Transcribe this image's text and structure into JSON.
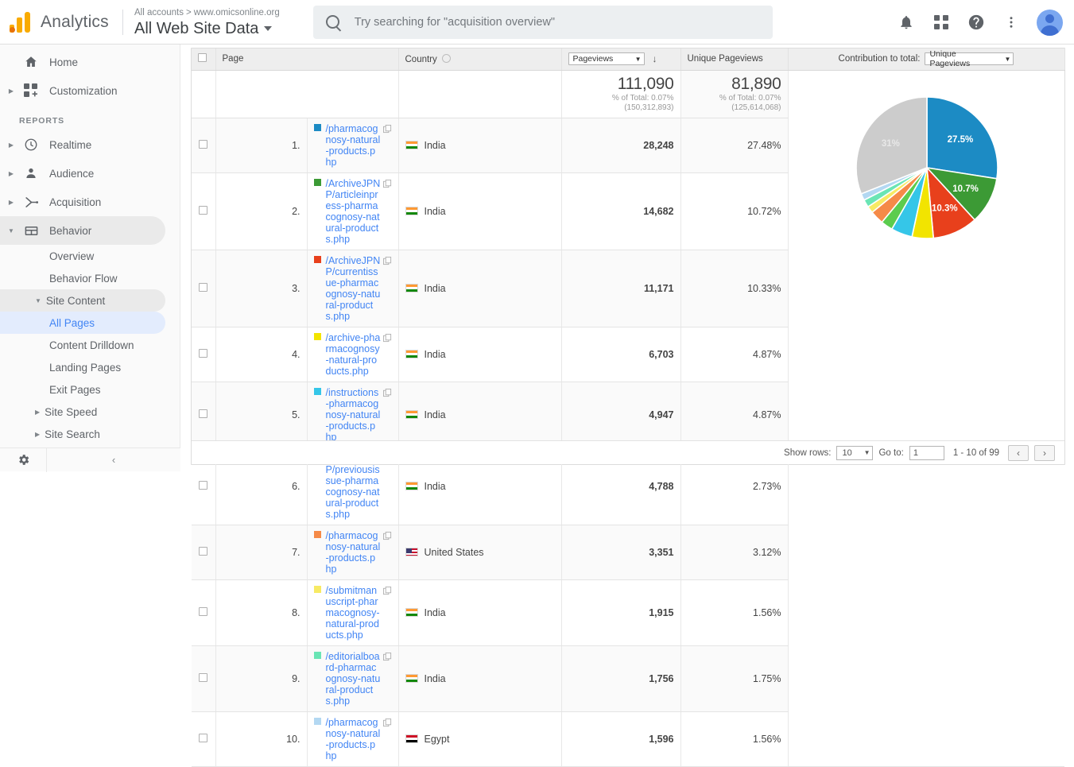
{
  "topbar": {
    "brand": "Analytics",
    "breadcrumb_account": "All accounts",
    "breadcrumb_sep": ">",
    "breadcrumb_property": "www.omicsonline.org",
    "view_name": "All Web Site Data",
    "search_placeholder": "Try searching for \"acquisition overview\"",
    "icons": [
      "notifications-bell-icon",
      "apps-grid-icon",
      "help-icon",
      "more-vert-icon",
      "avatar"
    ]
  },
  "sidebar": {
    "primary": [
      {
        "label": "Home",
        "icon": "home-icon",
        "expandable": false
      },
      {
        "label": "Customization",
        "icon": "customization-icon",
        "expandable": true
      }
    ],
    "section_label": "REPORTS",
    "reports": [
      {
        "label": "Realtime",
        "icon": "clock-icon",
        "expandable": true,
        "expanded": false
      },
      {
        "label": "Audience",
        "icon": "person-icon",
        "expandable": true,
        "expanded": false
      },
      {
        "label": "Acquisition",
        "icon": "acquisition-icon",
        "expandable": true,
        "expanded": false
      },
      {
        "label": "Behavior",
        "icon": "behavior-icon",
        "expandable": true,
        "expanded": true
      }
    ],
    "behavior_children": [
      {
        "label": "Overview",
        "type": "leaf",
        "selected": false
      },
      {
        "label": "Behavior Flow",
        "type": "leaf",
        "selected": false
      },
      {
        "label": "Site Content",
        "type": "group",
        "expanded": true
      },
      {
        "label": "All Pages",
        "type": "leaf-indent",
        "selected": true
      },
      {
        "label": "Content Drilldown",
        "type": "leaf-indent",
        "selected": false
      },
      {
        "label": "Landing Pages",
        "type": "leaf-indent",
        "selected": false
      },
      {
        "label": "Exit Pages",
        "type": "leaf-indent",
        "selected": false
      },
      {
        "label": "Site Speed",
        "type": "group",
        "expanded": false
      },
      {
        "label": "Site Search",
        "type": "group",
        "expanded": false
      }
    ],
    "footer": {
      "gear": "gear-icon",
      "collapse": "collapse-chevron-icon"
    }
  },
  "table": {
    "headers": {
      "page": "Page",
      "country": "Country",
      "pageviews_select": "Pageviews",
      "unique_pageviews": "Unique Pageviews",
      "contribution_label": "Contribution to total:",
      "contribution_select": "Unique Pageviews"
    },
    "summary": {
      "pageviews_value": "111,090",
      "pageviews_pct": "% of Total: 0.07%",
      "pageviews_total": "(150,312,893)",
      "unique_value": "81,890",
      "unique_pct": "% of Total: 0.07%",
      "unique_total": "(125,614,068)"
    },
    "rows": [
      {
        "index": "1.",
        "color": "#1c8bc4",
        "page": "/pharmacognosy-natural-products.php",
        "country": "India",
        "flag": "in",
        "pageviews": "28,248",
        "unique_pct": "27.48%"
      },
      {
        "index": "2.",
        "color": "#3c9a35",
        "page": "/ArchiveJPNP/articleinpress-pharmacognosy-natural-products.php",
        "country": "India",
        "flag": "in",
        "pageviews": "14,682",
        "unique_pct": "10.72%"
      },
      {
        "index": "3.",
        "color": "#e8401c",
        "page": "/ArchiveJPNP/currentissue-pharmacognosy-natural-products.php",
        "country": "India",
        "flag": "in",
        "pageviews": "11,171",
        "unique_pct": "10.33%"
      },
      {
        "index": "4.",
        "color": "#f2e400",
        "page": "/archive-pharmacognosy-natural-products.php",
        "country": "India",
        "flag": "in",
        "pageviews": "6,703",
        "unique_pct": "4.87%"
      },
      {
        "index": "5.",
        "color": "#35c6e8",
        "page": "/instructions-pharmacognosy-natural-products.php",
        "country": "India",
        "flag": "in",
        "pageviews": "4,947",
        "unique_pct": "4.87%"
      },
      {
        "index": "6.",
        "color": "#5ccc4e",
        "page": "/ArchiveJPNP/previousissue-pharmacognosy-natural-products.php",
        "country": "India",
        "flag": "in",
        "pageviews": "4,788",
        "unique_pct": "2.73%"
      },
      {
        "index": "7.",
        "color": "#f58a48",
        "page": "/pharmacognosy-natural-products.php",
        "country": "United States",
        "flag": "us",
        "pageviews": "3,351",
        "unique_pct": "3.12%"
      },
      {
        "index": "8.",
        "color": "#f7ea64",
        "page": "/submitmanuscript-pharmacognosy-natural-products.php",
        "country": "India",
        "flag": "in",
        "pageviews": "1,915",
        "unique_pct": "1.56%"
      },
      {
        "index": "9.",
        "color": "#6ae5b5",
        "page": "/editorialboard-pharmacognosy-natural-products.php",
        "country": "India",
        "flag": "in",
        "pageviews": "1,756",
        "unique_pct": "1.75%"
      },
      {
        "index": "10.",
        "color": "#b3d8f2",
        "page": "/pharmacognosy-natural-products.php",
        "country": "Egypt",
        "flag": "eg",
        "pageviews": "1,596",
        "unique_pct": "1.56%"
      }
    ]
  },
  "chart_data": {
    "type": "pie",
    "title": "Contribution to total: Unique Pageviews",
    "legend_position": "none",
    "labels_shown": [
      "27.5%",
      "10.7%",
      "10.3%",
      "31%"
    ],
    "slices": [
      {
        "name": "/pharmacognosy-natural-products.php (India)",
        "value": 27.48,
        "label": "27.5%",
        "color": "#1c8bc4",
        "show_label": true
      },
      {
        "name": "/ArchiveJPNP/articleinpress-pharmacognosy-natural-products.php (India)",
        "value": 10.72,
        "label": "10.7%",
        "color": "#3c9a35",
        "show_label": true
      },
      {
        "name": "/ArchiveJPNP/currentissue-pharmacognosy-natural-products.php (India)",
        "value": 10.33,
        "label": "10.3%",
        "color": "#e8401c",
        "show_label": true
      },
      {
        "name": "/archive-pharmacognosy-natural-products.php (India)",
        "value": 4.87,
        "label": "4.87%",
        "color": "#f2e400",
        "show_label": false
      },
      {
        "name": "/instructions-pharmacognosy-natural-products.php (India)",
        "value": 4.87,
        "label": "4.87%",
        "color": "#35c6e8",
        "show_label": false
      },
      {
        "name": "/ArchiveJPNP/previousissue-pharmacognosy-natural-products.php (India)",
        "value": 2.73,
        "label": "2.73%",
        "color": "#5ccc4e",
        "show_label": false
      },
      {
        "name": "/pharmacognosy-natural-products.php (United States)",
        "value": 3.12,
        "label": "3.12%",
        "color": "#f58a48",
        "show_label": false
      },
      {
        "name": "/submitmanuscript-pharmacognosy-natural-products.php (India)",
        "value": 1.56,
        "label": "1.56%",
        "color": "#f7ea64",
        "show_label": false
      },
      {
        "name": "/editorialboard-pharmacognosy-natural-products.php (India)",
        "value": 1.75,
        "label": "1.75%",
        "color": "#6ae5b5",
        "show_label": false
      },
      {
        "name": "/pharmacognosy-natural-products.php (Egypt)",
        "value": 1.56,
        "label": "1.56%",
        "color": "#b3d8f2",
        "show_label": false
      },
      {
        "name": "Other",
        "value": 31.01,
        "label": "31%",
        "color": "#cccccc",
        "show_label": true
      }
    ]
  },
  "footer": {
    "show_rows_label": "Show rows:",
    "show_rows_value": "10",
    "go_to_label": "Go to:",
    "go_to_value": "1",
    "range_text": "1 - 10 of 99",
    "prev": "‹",
    "next": "›"
  }
}
